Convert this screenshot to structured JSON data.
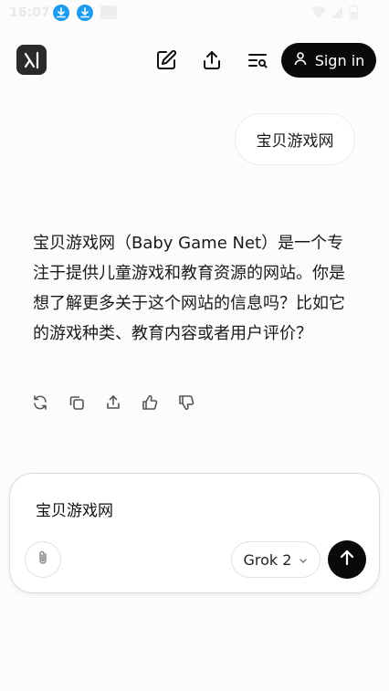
{
  "status_bar": {
    "time": "16:07",
    "icons": [
      "download-icon",
      "download-icon",
      "notification-icon",
      "wifi-icon",
      "signal-icon",
      "battery-icon"
    ]
  },
  "nav": {
    "logo": "grok-logo",
    "icons": [
      "new-chat-icon",
      "share-icon",
      "history-icon"
    ],
    "signin_label": "Sign in"
  },
  "conversation": {
    "user_message": "宝贝游戏网",
    "assistant_reply": "宝贝游戏网（Baby Game Net）是一个专注于提供儿童游戏和教育资源的网站。你是想了解更多关于这个网站的信息吗？比如它的游戏种类、教育内容或者用户评价？",
    "actions": [
      "regenerate-icon",
      "copy-icon",
      "share-icon",
      "thumbs-up-icon",
      "thumbs-down-icon"
    ]
  },
  "composer": {
    "value": "宝贝游戏网",
    "model_label": "Grok 2",
    "icons": [
      "attach-icon",
      "chevron-down-icon",
      "send-arrow-icon"
    ]
  },
  "colors": {
    "background": "#fcfcfc",
    "primary_dark": "#0a0a0a",
    "download_badge": "#1e9bf0"
  }
}
